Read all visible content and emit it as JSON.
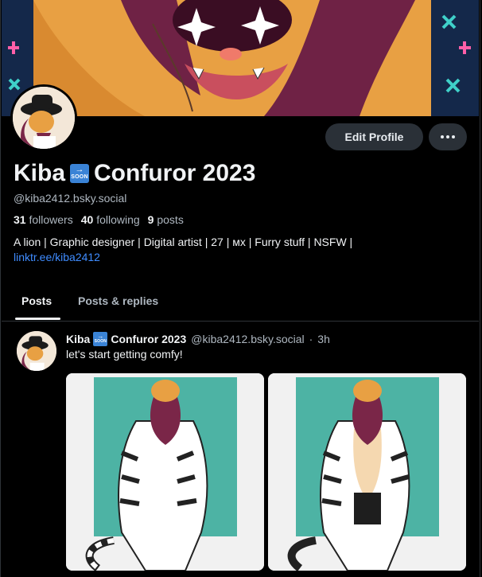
{
  "profile": {
    "display_name": "Kiba",
    "display_name_suffix": "Confuror 2023",
    "soon_emoji": {
      "arrow": "→",
      "text": "SOON"
    },
    "handle": "@kiba2412.bsky.social",
    "followers_count": "31",
    "followers_label": "followers",
    "following_count": "40",
    "following_label": "following",
    "posts_count": "9",
    "posts_label": "posts",
    "bio_text": "A lion | Graphic designer | Digital artist | 27 | ᴍx | Furry stuff | NSFW |",
    "bio_link": "linktr.ee/kiba2412"
  },
  "actions": {
    "edit_profile": "Edit Profile"
  },
  "tabs": [
    {
      "label": "Posts",
      "active": true
    },
    {
      "label": "Posts & replies",
      "active": false
    }
  ],
  "post": {
    "author_name": "Kiba",
    "author_suffix": "Confuror 2023",
    "author_handle": "@kiba2412.bsky.social",
    "separator": "·",
    "time": "3h",
    "text": "let's start getting comfy!"
  },
  "colors": {
    "background": "#000000",
    "banner_orange": "#e8a043",
    "accent_link": "#3f8cff",
    "button_bg": "#2a3037",
    "teal": "#4db3a4"
  }
}
